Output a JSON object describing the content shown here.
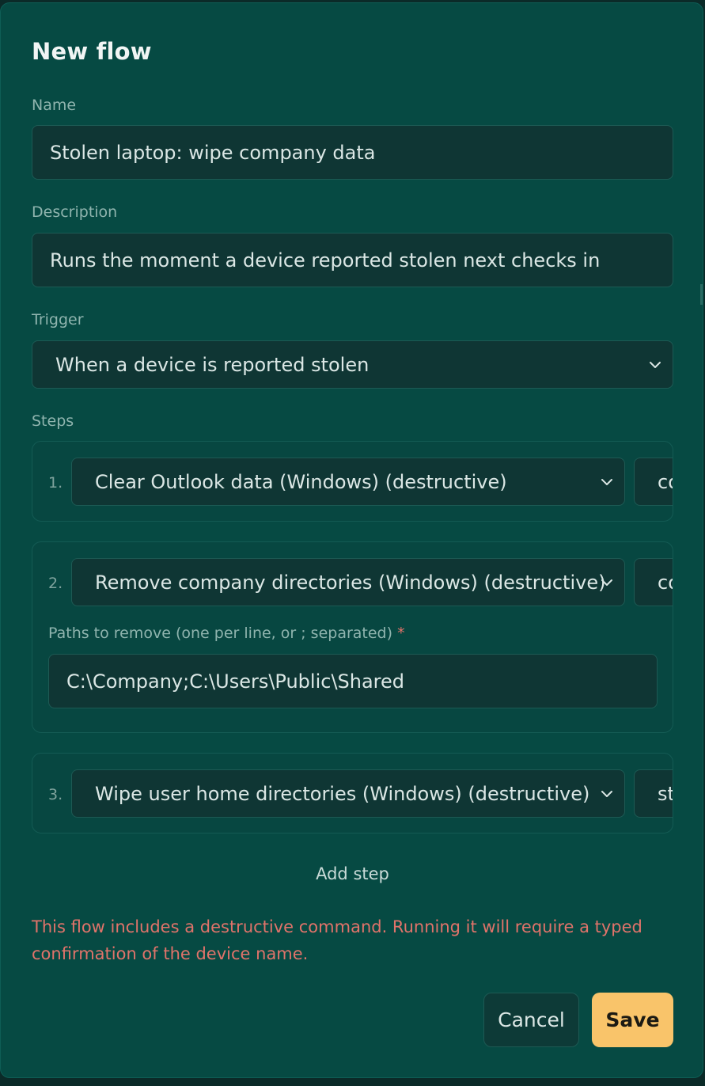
{
  "dialog": {
    "title": "New flow",
    "name": {
      "label": "Name",
      "value": "Stolen laptop: wipe company data"
    },
    "description": {
      "label": "Description",
      "value": "Runs the moment a device reported stolen next checks in"
    },
    "trigger": {
      "label": "Trigger",
      "value": "When a device is reported stolen"
    },
    "steps_label": "Steps",
    "steps": [
      {
        "number": "1.",
        "action": "Clear Outlook data (Windows) (destructive)",
        "param_visible": "co"
      },
      {
        "number": "2.",
        "action": "Remove company directories (Windows) (destructive)",
        "param_visible": "co",
        "extra_field": {
          "label": "Paths to remove (one per line, or ; separated)",
          "required_marker": "*",
          "value": "C:\\Company;C:\\Users\\Public\\Shared"
        }
      },
      {
        "number": "3.",
        "action": "Wipe user home directories (Windows) (destructive)",
        "param_visible": "st"
      }
    ],
    "add_step_label": "Add step",
    "warning": "This flow includes a destructive command. Running it will require a typed confirmation of the device name.",
    "cancel_label": "Cancel",
    "save_label": "Save"
  },
  "icons": {
    "select_arrow": "chevron-down-icon"
  },
  "colors": {
    "background": "#064a43",
    "field": "#0f3634",
    "accent": "#f9c46a",
    "warning": "#e0736a"
  }
}
